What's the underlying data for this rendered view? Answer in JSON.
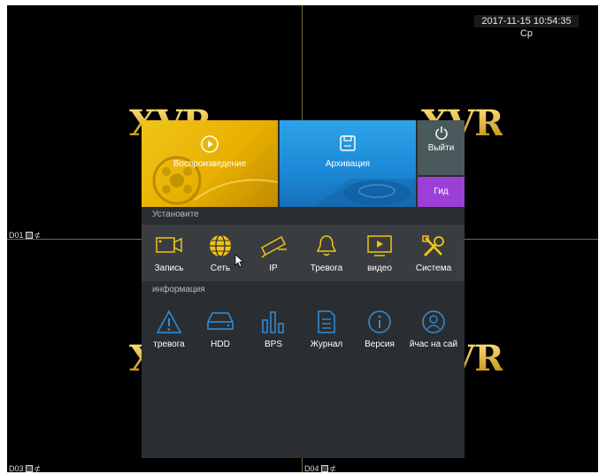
{
  "datetime": "2017-11-15 10:54:35 Ср",
  "logo_text": "XVR",
  "channels": [
    {
      "label": "D01"
    },
    {
      "label": "D03"
    },
    {
      "label": "D04"
    }
  ],
  "menu": {
    "tiles": {
      "playback": "Воспроизведение",
      "archive": "Архивация",
      "exit": "Выйти",
      "guide": "Гид"
    },
    "settings_title": "Установите",
    "settings_items": [
      {
        "label": "Запись",
        "icon": "camera-icon"
      },
      {
        "label": "Сеть",
        "icon": "globe-icon"
      },
      {
        "label": "IP",
        "icon": "ip-camera-icon"
      },
      {
        "label": "Тревога",
        "icon": "bell-icon"
      },
      {
        "label": "видео",
        "icon": "monitor-play-icon"
      },
      {
        "label": "Система",
        "icon": "tools-icon"
      }
    ],
    "info_title": "информация",
    "info_items": [
      {
        "label": "тревога",
        "icon": "warning-icon"
      },
      {
        "label": "HDD",
        "icon": "hdd-icon"
      },
      {
        "label": "BPS",
        "icon": "bars-icon"
      },
      {
        "label": "Журнал",
        "icon": "log-icon"
      },
      {
        "label": "Версия",
        "icon": "info-icon"
      },
      {
        "label": "йчас на сай",
        "icon": "user-icon"
      }
    ]
  },
  "colors": {
    "accent_yellow": "#f0c419",
    "accent_blue": "#1b88d6",
    "accent_purple": "#9b3fd6"
  }
}
